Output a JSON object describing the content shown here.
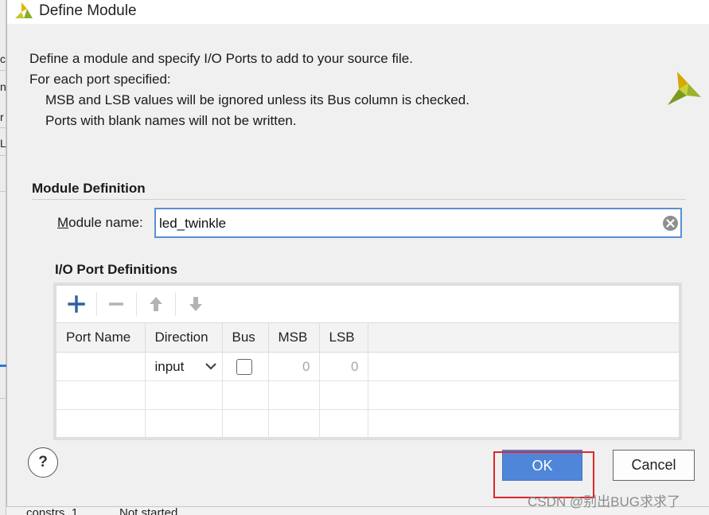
{
  "background_app": {
    "left_fragments": [
      "c",
      "nt",
      "r",
      "L"
    ],
    "bottom_row": [
      "constrs_1",
      "Not started"
    ]
  },
  "dialog": {
    "title": "Define Module",
    "intro": {
      "line1": "Define a module and specify I/O Ports to add to your source file.",
      "line2": "For each port specified:",
      "line3": "MSB and LSB values will be ignored unless its Bus column is checked.",
      "line4": "Ports with blank names will not be written."
    },
    "module_definition": {
      "section_title": "Module Definition",
      "name_label_accel": "M",
      "name_label_rest": "odule name:",
      "name_value": "led_twinkle"
    },
    "io_ports": {
      "title": "I/O Port Definitions",
      "toolbar": [
        "add-icon",
        "remove-icon",
        "move-up-icon",
        "move-down-icon"
      ],
      "columns": [
        "Port Name",
        "Direction",
        "Bus",
        "MSB",
        "LSB"
      ],
      "rows": [
        {
          "port_name": "",
          "direction": "input",
          "bus": false,
          "msb": "0",
          "lsb": "0"
        }
      ]
    },
    "buttons": {
      "help": "?",
      "ok": "OK",
      "cancel": "Cancel"
    }
  },
  "colors": {
    "ok_button": "#4f86d9",
    "highlight_box": "#e0262b",
    "field_focus_border": "#5a8fd4"
  },
  "watermark": "CSDN @别出BUG求求了"
}
